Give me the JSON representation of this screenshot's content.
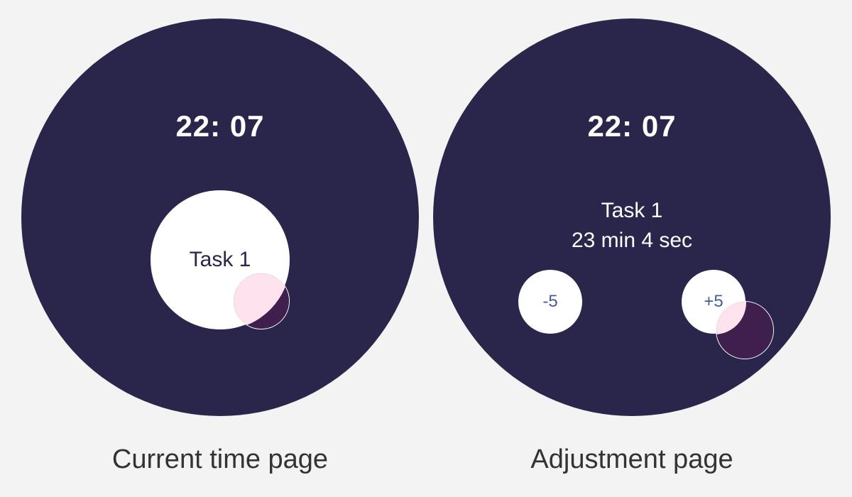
{
  "left_page": {
    "time": "22: 07",
    "task_label": "Task 1",
    "caption": "Current time page"
  },
  "right_page": {
    "time": "22: 07",
    "task_label": "Task 1",
    "task_duration": "23 min 4 sec",
    "minus_label": "-5",
    "plus_label": "+5",
    "caption": "Adjustment page"
  },
  "colors": {
    "background": "#f3f3f3",
    "watch_face": "#2a254a",
    "touch_indicator": "#3f1f4e",
    "touch_overlap": "#fde3ee",
    "button_text": "#4a5a9a"
  }
}
